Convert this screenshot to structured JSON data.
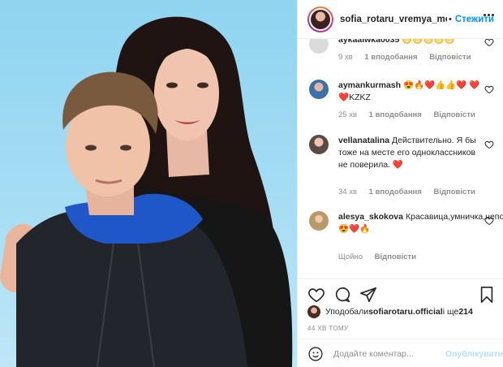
{
  "post": {
    "username": "sofia_rotaru_vremya_mc",
    "separator": "•",
    "follow_label": "Стежити"
  },
  "comments": [
    {
      "user": "aykaalwka0035",
      "text": "😁😁😁😁😁",
      "time": "9 хв",
      "likes": "1 вподобання",
      "reply": "Відповісти"
    },
    {
      "user": "aymankurmash",
      "text": "😍🔥❤️👍👍❤️ ❤️❤️KZKZ",
      "time": "25 хв",
      "likes": "1 вподобання",
      "reply": "Відповісти"
    },
    {
      "user": "vellanatalina",
      "text": "Действительно. Я бы тоже на месте его одноклассников не поверила. ❤️",
      "time": "34 хв",
      "likes": "1 вподобання",
      "reply": "Відповісти"
    },
    {
      "user": "alesya_skokova",
      "text": "Красавица,умничка,неповторимая.😍❤️🔥",
      "time": "Щойно",
      "likes": "",
      "reply": "Відповісти"
    }
  ],
  "likes": {
    "prefix": "Уподобали ",
    "user": "sofiarotaru.official",
    "suffix": " і ще ",
    "count": "214"
  },
  "timestamp": "44 ХВ ТОМУ",
  "add_comment": {
    "placeholder": "Додайте коментар...",
    "post_label": "Опублікувати"
  },
  "icons": {
    "like": "heart-icon",
    "comment": "comment-icon",
    "share": "send-icon",
    "save": "bookmark-icon",
    "more": "more-icon",
    "emoji": "smile-icon"
  },
  "colors": {
    "accent": "#0095f6",
    "muted": "#8e8e8e",
    "border": "#efefef",
    "text": "#262626",
    "post_disabled": "#b2dffc",
    "photo_bg": "#a6ddf4"
  }
}
